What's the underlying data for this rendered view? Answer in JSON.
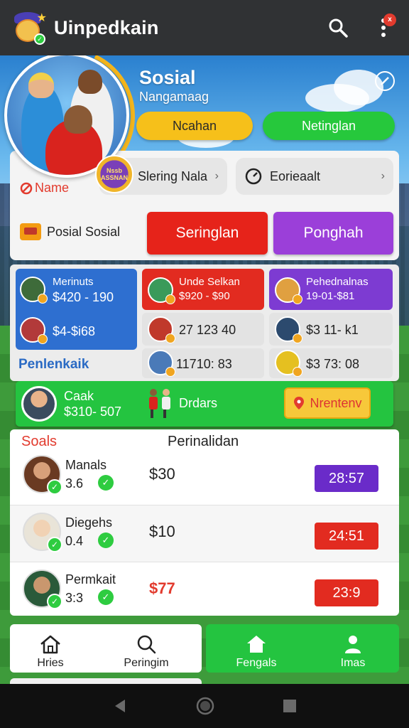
{
  "app": {
    "title": "Uinpedkain",
    "notification_count": "x"
  },
  "hero": {
    "title": "Sosial",
    "subtitle": "Nangamaag",
    "btn_yellow": "Ncahan",
    "btn_green": "Netinglan"
  },
  "profile": {
    "name_label": "Name",
    "medal_text": "Nssb ASSNAN",
    "chip1": "Slering Nala",
    "chip2": "Eorieaalt",
    "posial": "Posial Sosial",
    "btn_red": "Seringlan",
    "btn_purple": "Ponghah"
  },
  "stats": {
    "blue": {
      "title": "Merinuts",
      "value": "$420 - 190",
      "value2": "$4-$i68"
    },
    "red": {
      "title": "Unde Selkan",
      "value": "$920 - $90"
    },
    "purple": {
      "title": "Pehednalnas",
      "value": "19-01-$81"
    },
    "cell_mid_1": "27 123 40",
    "cell_right_1": "$3 11- k1",
    "cell_mid_2": "11710: 83",
    "cell_right_2": "$3 73: 08",
    "section_label": "Penlenkaik"
  },
  "banner": {
    "name": "Caak",
    "value": "$310- 507",
    "label": "Drdars",
    "button": "Nrentenv"
  },
  "list": {
    "head_left": "Soals",
    "head_center": "Perinalidan",
    "rows": [
      {
        "name": "Manals",
        "score": "3.6",
        "price": "$30",
        "tag": "28:57",
        "tag_color": "#6a2bc9"
      },
      {
        "name": "Diegehs",
        "score": "0.4",
        "price": "$10",
        "tag": "24:51",
        "tag_color": "#e22b20"
      },
      {
        "name": "Permkait",
        "score": "3:3",
        "price": "$77",
        "tag": "23:9",
        "tag_color": "#e22b20"
      }
    ]
  },
  "tabs": {
    "home": "Hries",
    "search": "Peringim",
    "fengals": "Fengals",
    "imas": "Imas"
  },
  "colors": {
    "accent_green": "#24c440",
    "accent_red": "#e22b20",
    "accent_purple": "#9b3fd9",
    "accent_yellow": "#f6c01a",
    "accent_blue": "#2e6fd0"
  }
}
